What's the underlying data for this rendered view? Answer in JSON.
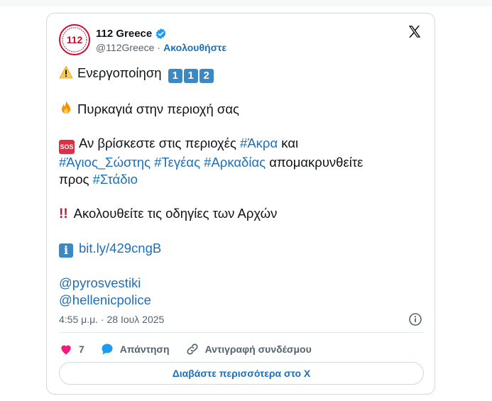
{
  "account": {
    "name": "112 Greece",
    "handle": "@112Greece",
    "separator": "·",
    "follow_label": "Ακολουθήστε",
    "avatar_text": "112"
  },
  "tweet": {
    "line1_text": "Ενεργοποίηση",
    "line1_keycaps": [
      "1",
      "1",
      "2"
    ],
    "line2_text": "Πυρκαγιά στην περιοχή σας",
    "sos_badge": "SOS",
    "line3_pre": "Αν βρίσκεστε στις περιοχές",
    "line3_hashtag": "#Άκρα",
    "line3_post": "και",
    "line4_hashtags": [
      "#Άγιος_Σώστης",
      "#Τεγέας",
      "#Αρκαδίας"
    ],
    "line4_post": "απομακρυνθείτε",
    "line5_pre": "προς",
    "line5_hashtag": "#Στάδιο",
    "line6_text": "Ακολουθείτε τις οδηγίες των Αρχών",
    "link": "bit.ly/429cngB",
    "mentions": [
      "@pyrosvestiki",
      "@hellenicpolice"
    ]
  },
  "timestamp": "4:55 μ.μ. · 28 Ιουλ 2025",
  "actions": {
    "like_count": "7",
    "reply_label": "Απάντηση",
    "copy_link_label": "Αντιγραφή συνδέσμου"
  },
  "read_more_label": "Διαβάστε περισσότερα στο X",
  "colors": {
    "link": "#1d6fb8",
    "muted": "#536471",
    "border": "#cfd9de",
    "like": "#f91880",
    "reply": "#1d9bf0",
    "verified": "#1d9bf0",
    "avatar_red": "#c8102e"
  },
  "icons": {
    "warning": "warning-icon",
    "fire": "fire-icon",
    "sos": "sos-icon",
    "exclamation": "double-exclamation-icon",
    "info": "info-icon",
    "verified": "verified-badge-icon",
    "x_logo": "x-logo-icon",
    "info_button": "info-circle-icon",
    "like": "heart-icon",
    "reply": "speech-bubble-icon",
    "copy_link": "link-icon"
  }
}
